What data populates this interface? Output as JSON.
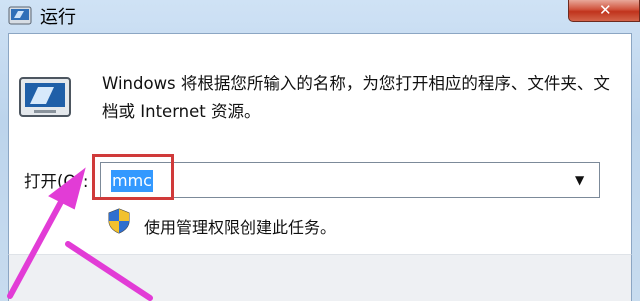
{
  "window": {
    "title": "运行",
    "close_label": "✕"
  },
  "dialog": {
    "description": "Windows 将根据您所输入的名称，为您打开相应的程序、文件夹、文档或 Internet 资源。",
    "open_label": "打开(O):",
    "input_value": "mmc",
    "admin_note": "使用管理权限创建此任务。"
  },
  "icons": {
    "title": "run-icon",
    "dialog": "run-icon",
    "shield": "uac-shield-icon",
    "dropdown": "chevron-down-icon"
  },
  "colors": {
    "selection": "#3399ff",
    "highlight_box": "#d03a3a",
    "annotation_arrow": "#e23cd6"
  }
}
